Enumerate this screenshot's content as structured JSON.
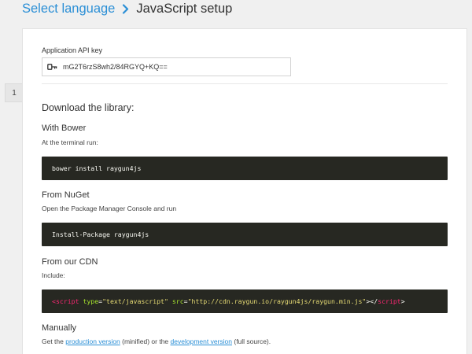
{
  "breadcrumb": {
    "link": "Select language",
    "current": "JavaScript setup"
  },
  "step_number": "1",
  "api_key": {
    "label": "Application API key",
    "value": "mG2T6rzS8wh2/84RGYQ+KQ=="
  },
  "download": {
    "heading": "Download the library:",
    "bower": {
      "heading": "With Bower",
      "desc": "At the terminal run:",
      "code": "bower install raygun4js"
    },
    "nuget": {
      "heading": "From NuGet",
      "desc": "Open the Package Manager Console and run",
      "code": "Install-Package raygun4js"
    },
    "cdn": {
      "heading": "From our CDN",
      "desc": "Include:",
      "code": {
        "open_bracket": "<",
        "tag": "script",
        "attr1": "type",
        "eq1": "=",
        "val1": "\"text/javascript\"",
        "attr2": "src",
        "eq2": "=",
        "val2": "\"http://cdn.raygun.io/raygun4js/raygun.min.js\"",
        "close_open": "></",
        "close_tag": "script",
        "end": ">"
      }
    },
    "manual": {
      "heading": "Manually",
      "text_prefix": "Get the",
      "link1": "production version",
      "text_mid": "(minified) or the",
      "link2": "development version",
      "text_suffix": "(full source)."
    }
  },
  "colors": {
    "accent": "#2b8fd6",
    "code_bg": "#272822"
  },
  "icons": {
    "breadcrumb_separator": "chevron-right-icon",
    "api_key": "key-icon"
  }
}
